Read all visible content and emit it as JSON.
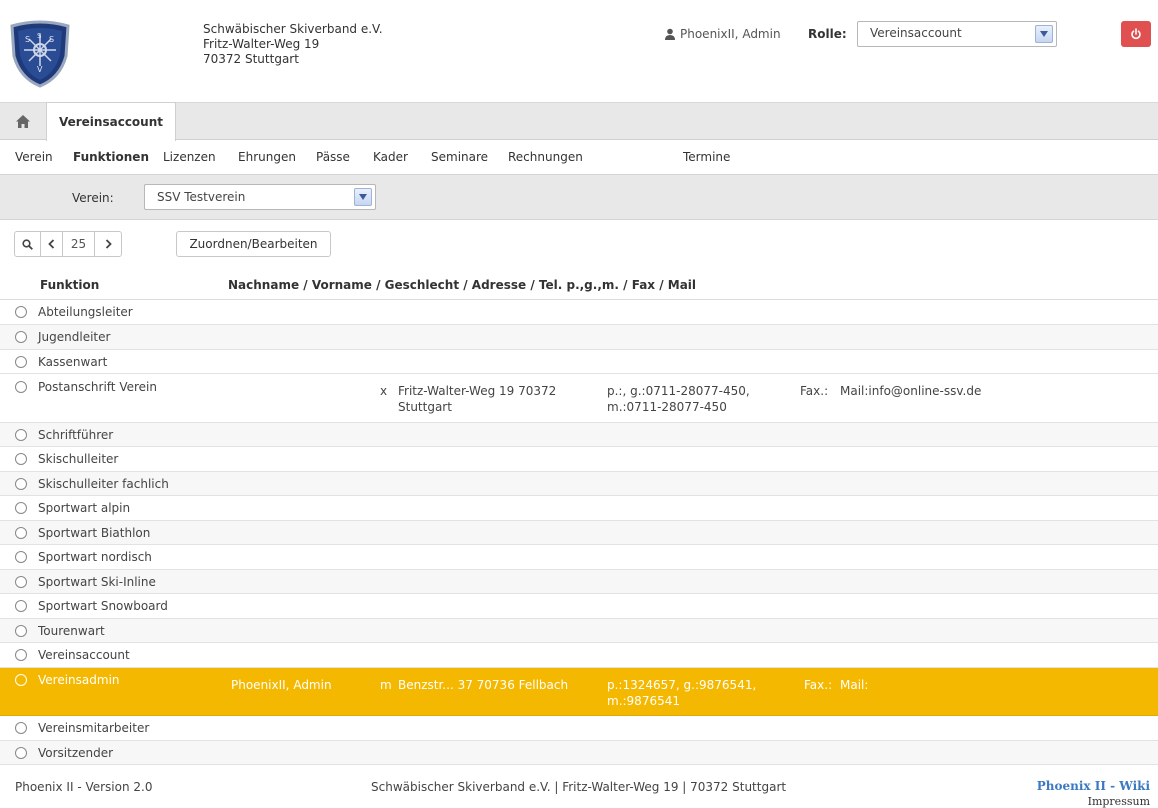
{
  "header": {
    "org_name": "Schwäbischer Skiverband e.V.",
    "org_street": "Fritz-Walter-Weg 19",
    "org_city": "70372 Stuttgart",
    "user_name": "PhoenixII, Admin",
    "role_label": "Rolle:",
    "role_value": "Vereinsaccount"
  },
  "tabs": {
    "active": "Vereinsaccount"
  },
  "menu": {
    "items": [
      "Verein",
      "Funktionen",
      "Lizenzen",
      "Ehrungen",
      "Pässe",
      "Kader",
      "Seminare",
      "Rechnungen",
      "Termine"
    ],
    "active": "Funktionen"
  },
  "filter": {
    "label": "Verein:",
    "value": "SSV Testverein"
  },
  "toolbar": {
    "page_size": "25",
    "assign_label": "Zuordnen/Bearbeiten"
  },
  "table": {
    "headers": [
      "Funktion",
      "Nachname / Vorname / Geschlecht / Adresse / Tel. p.,g.,m. / Fax / Mail"
    ],
    "rows": [
      {
        "funktion": "Abteilungsleiter"
      },
      {
        "funktion": "Jugendleiter"
      },
      {
        "funktion": "Kassenwart"
      },
      {
        "funktion": "Postanschrift Verein",
        "gender": "x",
        "address": "Fritz-Walter-Weg 19 70372",
        "address2": "Stuttgart",
        "phone": "p.:, g.:0711-28077-450,",
        "phone2": "m.:0711-28077-450",
        "fax": "Fax.:",
        "mail": "Mail:info@online-ssv.de"
      },
      {
        "funktion": "Schriftführer"
      },
      {
        "funktion": "Skischulleiter"
      },
      {
        "funktion": "Skischulleiter fachlich"
      },
      {
        "funktion": "Sportwart alpin"
      },
      {
        "funktion": "Sportwart Biathlon"
      },
      {
        "funktion": "Sportwart nordisch"
      },
      {
        "funktion": "Sportwart Ski-Inline"
      },
      {
        "funktion": "Sportwart Snowboard"
      },
      {
        "funktion": "Tourenwart"
      },
      {
        "funktion": "Vereinsaccount"
      },
      {
        "funktion": "Vereinsadmin",
        "name": "PhoenixII, Admin",
        "gender": "m",
        "address": "Benzstr... 37 70736 Fellbach",
        "phone": "p.:1324657, g.:9876541,",
        "phone2": "m.:9876541",
        "fax": "Fax.:",
        "mail": "Mail:"
      },
      {
        "funktion": "Vereinsmitarbeiter"
      },
      {
        "funktion": "Vorsitzender"
      }
    ]
  },
  "footer": {
    "version": "Phoenix II - Version 2.0",
    "center": "Schwäbischer Skiverband e.V. | Fritz-Walter-Weg 19 | 70372 Stuttgart",
    "wiki": "Phoenix II - Wiki",
    "impressum": "Impressum"
  },
  "colors": {
    "selected_row": "#f5b800",
    "power_button": "#e05050",
    "wiki_link": "#3b79c2"
  }
}
